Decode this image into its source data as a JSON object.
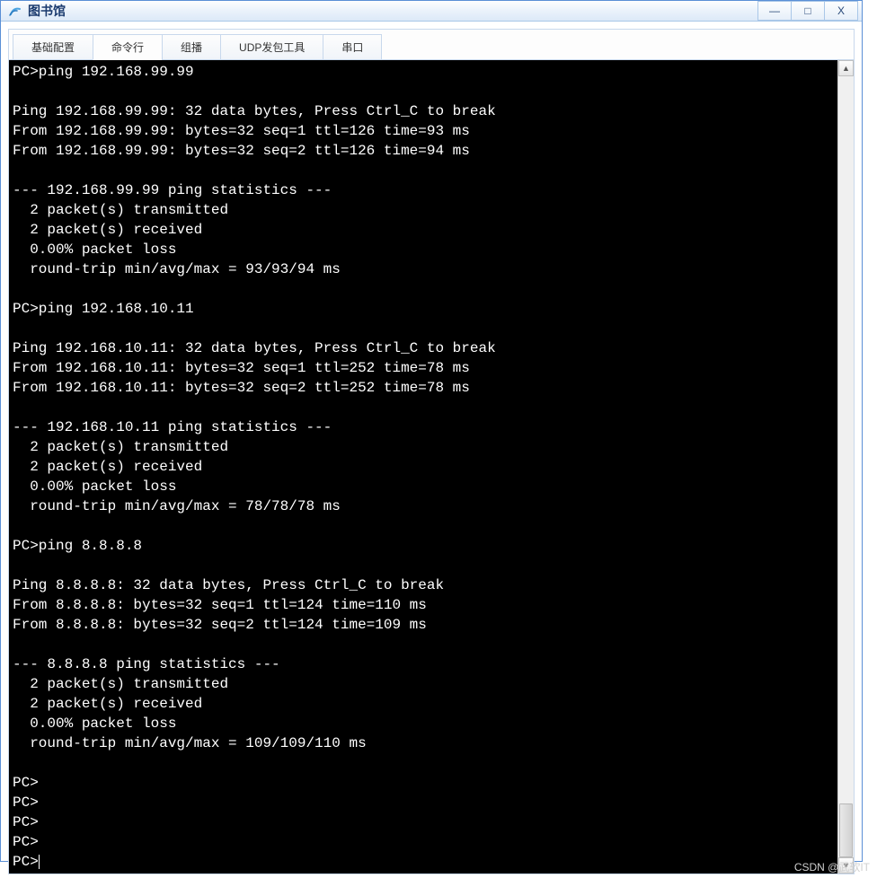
{
  "window": {
    "title": "图书馆",
    "controls": {
      "min": "—",
      "max": "□",
      "close": "X"
    }
  },
  "tabs": [
    {
      "label": "基础配置",
      "active": false
    },
    {
      "label": "命令行",
      "active": true
    },
    {
      "label": "组播",
      "active": false
    },
    {
      "label": "UDP发包工具",
      "active": false
    },
    {
      "label": "串口",
      "active": false
    }
  ],
  "terminal": {
    "lines": [
      "PC>ping 192.168.99.99",
      "",
      "Ping 192.168.99.99: 32 data bytes, Press Ctrl_C to break",
      "From 192.168.99.99: bytes=32 seq=1 ttl=126 time=93 ms",
      "From 192.168.99.99: bytes=32 seq=2 ttl=126 time=94 ms",
      "",
      "--- 192.168.99.99 ping statistics ---",
      "  2 packet(s) transmitted",
      "  2 packet(s) received",
      "  0.00% packet loss",
      "  round-trip min/avg/max = 93/93/94 ms",
      "",
      "PC>ping 192.168.10.11",
      "",
      "Ping 192.168.10.11: 32 data bytes, Press Ctrl_C to break",
      "From 192.168.10.11: bytes=32 seq=1 ttl=252 time=78 ms",
      "From 192.168.10.11: bytes=32 seq=2 ttl=252 time=78 ms",
      "",
      "--- 192.168.10.11 ping statistics ---",
      "  2 packet(s) transmitted",
      "  2 packet(s) received",
      "  0.00% packet loss",
      "  round-trip min/avg/max = 78/78/78 ms",
      "",
      "PC>ping 8.8.8.8",
      "",
      "Ping 8.8.8.8: 32 data bytes, Press Ctrl_C to break",
      "From 8.8.8.8: bytes=32 seq=1 ttl=124 time=110 ms",
      "From 8.8.8.8: bytes=32 seq=2 ttl=124 time=109 ms",
      "",
      "--- 8.8.8.8 ping statistics ---",
      "  2 packet(s) transmitted",
      "  2 packet(s) received",
      "  0.00% packet loss",
      "  round-trip min/avg/max = 109/109/110 ms",
      "",
      "PC>",
      "PC>",
      "PC>",
      "PC>",
      "PC>"
    ]
  },
  "watermark": "CSDN @武软IT"
}
